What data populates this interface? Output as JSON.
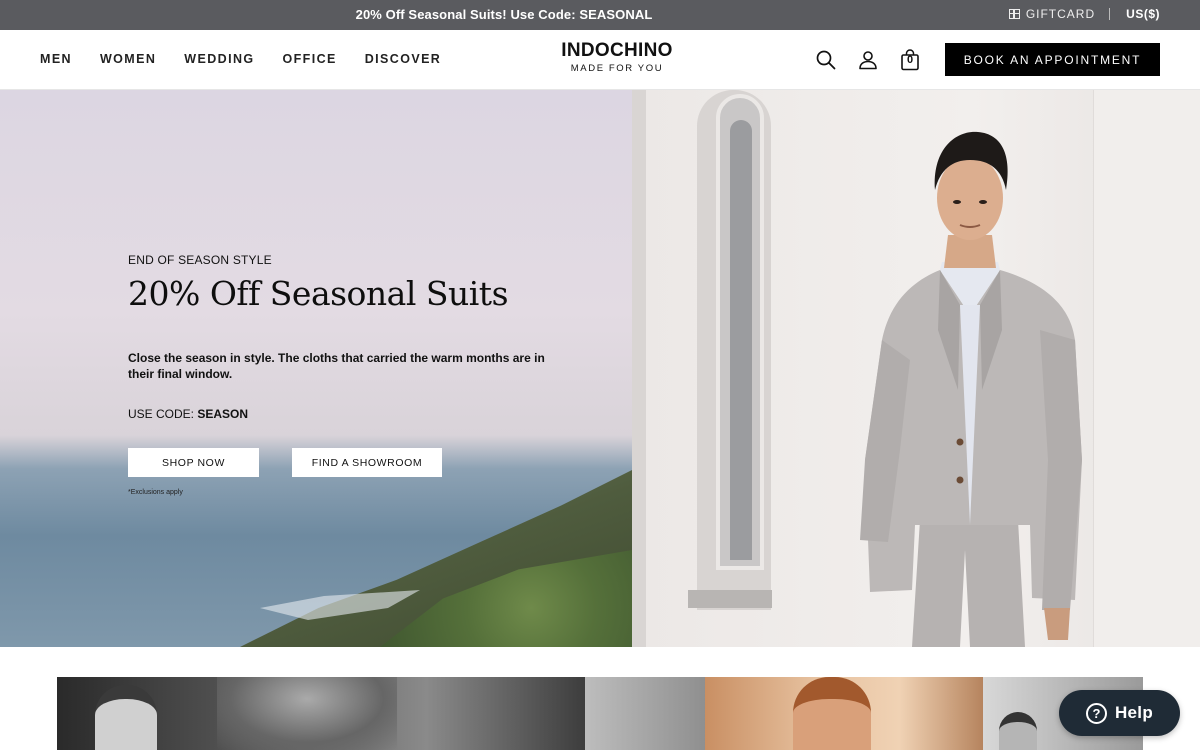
{
  "announcement": {
    "text": "20% Off Seasonal Suits! Use Code: SEASONAL",
    "giftcard_label": "GIFTCARD",
    "currency": "US($)"
  },
  "header": {
    "nav": [
      "MEN",
      "WOMEN",
      "WEDDING",
      "OFFICE",
      "DISCOVER"
    ],
    "logo_main": "INDOCHINO",
    "logo_sub": "MADE FOR YOU",
    "cart_count": "0",
    "book_label": "BOOK AN APPOINTMENT",
    "icons": [
      "search-icon",
      "account-icon",
      "cart-bag-icon"
    ]
  },
  "hero": {
    "eyebrow": "END OF SEASON STYLE",
    "headline": "20% Off Seasonal Suits",
    "body": "Close the season in style. The cloths that carried the warm months are in their final window.",
    "code_prefix": "USE CODE: ",
    "code": "SEASON",
    "shop_label": "SHOP NOW",
    "find_label": "FIND A SHOWROOM",
    "exclusions": "*Exclusions apply"
  },
  "help": {
    "label": "Help",
    "icon_glyph": "?"
  },
  "colors": {
    "announce_bg": "#5a5b5f",
    "button_dark": "#000000",
    "help_bg": "#1f2b36"
  }
}
